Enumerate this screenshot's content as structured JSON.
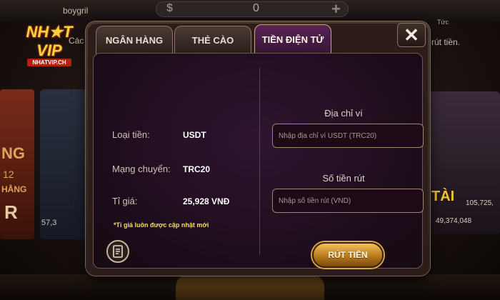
{
  "background": {
    "username": "boygril",
    "balance": "0",
    "currency_symbol": "$",
    "add_symbol": "+",
    "right_top_label": "Tức",
    "left_hint": "Các",
    "right_hint": "rút tiền.",
    "left_card_lines": [
      "NG",
      "12",
      "HẰNG",
      "R"
    ],
    "left_card_amount": "57,3",
    "right_card_title": "TÀI",
    "right_card_amount_1": "105,725,",
    "right_card_amount_2": "49,374,048"
  },
  "logo": {
    "line1": "NH★T",
    "line2": "VIP",
    "domain": "NHATVIP.CH"
  },
  "dialog": {
    "tabs": [
      {
        "label": "NGÂN HÀNG",
        "active": false
      },
      {
        "label": "THẺ CÀO",
        "active": false
      },
      {
        "label": "TIỀN ĐIỆN TỬ",
        "active": true
      }
    ],
    "close_label": "✕",
    "info": {
      "currency_label": "Loại tiền:",
      "currency_value": "USDT",
      "network_label": "Mạng chuyển:",
      "network_value": "TRC20",
      "rate_label": "Tỉ giá:",
      "rate_value": "25,928 VNĐ",
      "note": "*Tỉ giá luôn được cập nhật mới"
    },
    "form": {
      "address_label": "Địa chỉ ví",
      "address_placeholder": "Nhập địa chỉ ví USDT (TRC20)",
      "address_value": "",
      "amount_label": "Số tiền rút",
      "amount_placeholder": "Nhập số tiền rút (VND)",
      "amount_value": "",
      "submit_label": "RÚT TIỀN"
    }
  },
  "colors": {
    "accent_gold": "#f2c15d",
    "note_yellow": "#f7e04a",
    "panel_purple": "#2f1530"
  }
}
